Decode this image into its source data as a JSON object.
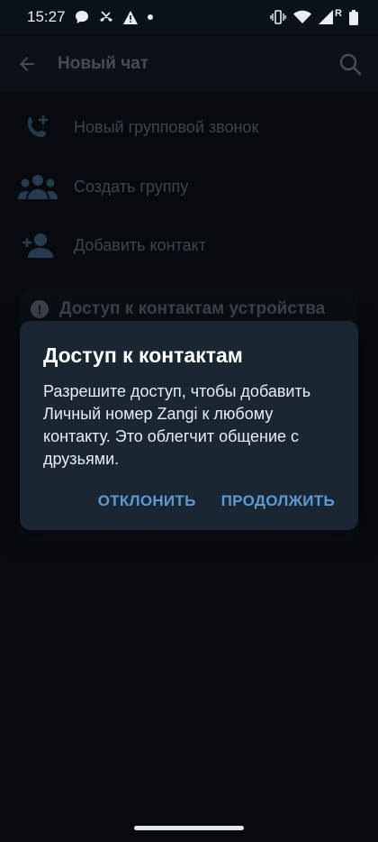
{
  "status_bar": {
    "time": "15:27",
    "roaming_indicator": "R"
  },
  "app_bar": {
    "title": "Новый чат",
    "back_icon": "arrow-back-icon",
    "search_icon": "search-icon"
  },
  "menu": {
    "items": [
      {
        "label": "Новый групповой звонок",
        "icon": "phone-plus-icon"
      },
      {
        "label": "Создать группу",
        "icon": "group-icon"
      },
      {
        "label": "Добавить контакт",
        "icon": "person-add-icon"
      }
    ]
  },
  "permission_banner": {
    "title": "Доступ к контактам устройства",
    "icon": "warning-icon"
  },
  "dialog": {
    "title": "Доступ к контактам",
    "message": "Разрешите доступ, чтобы добавить Личный номер Zangi к любому контакту. Это облегчит общение с друзьями.",
    "decline_label": "ОТКЛОНИТЬ",
    "continue_label": "ПРОДОЛЖИТЬ"
  },
  "colors": {
    "background": "#0b1118",
    "dialog_bg": "#1b2633",
    "accent": "#5b9bd5",
    "muted_text": "#5f6a76"
  }
}
